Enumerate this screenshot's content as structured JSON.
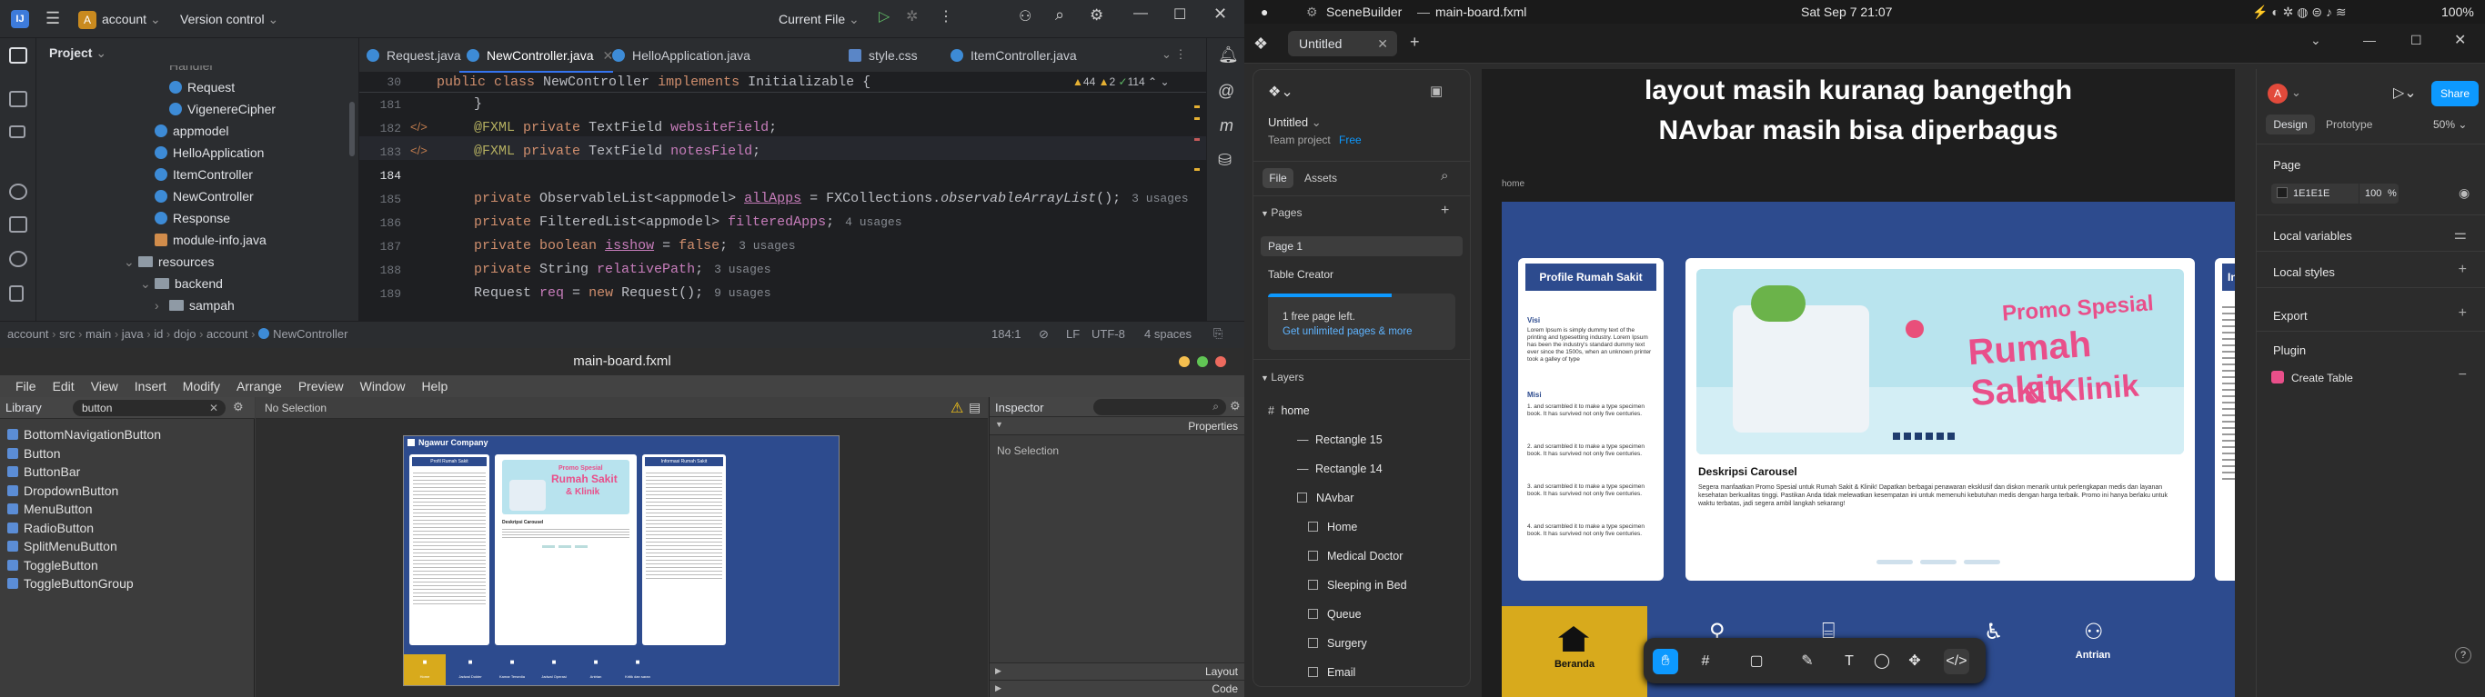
{
  "ide": {
    "project_name": "account",
    "project_initial": "A",
    "vcs_label": "Version control",
    "run_config": "Current File",
    "panel_title": "Project",
    "tabs": [
      {
        "label": "Request.java"
      },
      {
        "label": "NewController.java"
      },
      {
        "label": "HelloApplication.java"
      },
      {
        "label": "style.css"
      },
      {
        "label": "ItemController.java"
      }
    ],
    "tree": [
      {
        "label": "Request",
        "kind": "class"
      },
      {
        "label": "VigenereCipher",
        "kind": "class"
      },
      {
        "label": "appmodel",
        "kind": "class"
      },
      {
        "label": "HelloApplication",
        "kind": "class"
      },
      {
        "label": "ItemController",
        "kind": "class"
      },
      {
        "label": "NewController",
        "kind": "class"
      },
      {
        "label": "Response",
        "kind": "class"
      },
      {
        "label": "module-info.java",
        "kind": "file"
      },
      {
        "label": "resources",
        "kind": "folder"
      },
      {
        "label": "backend",
        "kind": "folder"
      },
      {
        "label": "sampah",
        "kind": "folder"
      }
    ],
    "sticky_line": "30",
    "sticky_code": "public class NewController implements Initializable {",
    "inspections": {
      "warnings": "44",
      "errors": "2",
      "checks": "114"
    },
    "lines": [
      "181",
      "182",
      "183",
      "184",
      "185",
      "186",
      "187",
      "188",
      "189"
    ],
    "hints": {
      "l185": "3 usages",
      "l186": "4 usages",
      "l187": "3 usages",
      "l188": "3 usages",
      "l189": "9 usages"
    },
    "breadcrumb": [
      "account",
      "src",
      "main",
      "java",
      "id",
      "dojo",
      "account",
      "NewController"
    ],
    "status": {
      "position": "184:1",
      "line_sep": "LF",
      "encoding": "UTF-8",
      "indent": "4 spaces"
    }
  },
  "scenebuilder": {
    "window_title": "main-board.fxml",
    "menu": [
      "File",
      "Edit",
      "View",
      "Insert",
      "Modify",
      "Arrange",
      "Preview",
      "Window",
      "Help"
    ],
    "library_label": "Library",
    "search_value": "button",
    "selection": "No Selection",
    "inspector_label": "Inspector",
    "properties_label": "Properties",
    "inspector_selection": "No Selection",
    "layout_label": "Layout",
    "code_label": "Code",
    "library_items": [
      "BottomNavigationButton",
      "Button",
      "ButtonBar",
      "DropdownButton",
      "MenuButton",
      "RadioButton",
      "SplitMenuButton",
      "ToggleButton",
      "ToggleButtonGroup"
    ],
    "preview": {
      "company": "Ngawur Company",
      "left_card": "Profil Rumah Sakit",
      "right_card": "Informasi Rumah Sakit",
      "banner_line1": "Promo Spesial",
      "banner_line2": "Rumah Sakit",
      "banner_line3": "& Klinik",
      "desc_title": "Deskripsi Carousel",
      "nav": [
        "Home",
        "Jadwal Dokter",
        "Kamar Tersedia",
        "Jadwal Operasi",
        "Antrian",
        "Kritik dan saran"
      ]
    }
  },
  "figma": {
    "app_name": "SceneBuilder",
    "window_title": "main-board.fxml",
    "clock": "Sat Sep 7  21:07",
    "battery": "100%",
    "tab_label": "Untitled",
    "file_name": "Untitled",
    "team": "Team project",
    "plan": "Free",
    "file_tab": "File",
    "assets_tab": "Assets",
    "pages_label": "Pages",
    "pages": [
      "Page 1",
      "Table Creator"
    ],
    "banner_text": "1 free page left.",
    "banner_link": "Get unlimited pages & more",
    "layers_label": "Layers",
    "layers": [
      {
        "label": "home",
        "indent": 0
      },
      {
        "label": "Rectangle 15",
        "indent": 1
      },
      {
        "label": "Rectangle 14",
        "indent": 1
      },
      {
        "label": "NAvbar",
        "indent": 1
      },
      {
        "label": "Home",
        "indent": 2
      },
      {
        "label": "Medical Doctor",
        "indent": 2
      },
      {
        "label": "Sleeping in Bed",
        "indent": 2
      },
      {
        "label": "Queue",
        "indent": 2
      },
      {
        "label": "Surgery",
        "indent": 2
      },
      {
        "label": "Email",
        "indent": 2
      }
    ],
    "note_line1": "layout masih kuranag bangethgh",
    "note_line2": "NAvbar masih bisa diperbagus",
    "frame_label": "home",
    "canvas": {
      "profil_title": "Profile Rumah Sakit",
      "info_title": "Inform",
      "visi": "Visi",
      "misi": "Misi",
      "lorem": "Lorem Ipsum is simply dummy text of the printing and typesetting industry. Lorem Ipsum has been the industry's standard dummy text ever since the 1500s, when an unknown printer took a galley of type",
      "misi_items": [
        "and scrambled it to make a type specimen book. It has survived not only five centuries.",
        "and scrambled it to make a type specimen book. It has survived not only five centuries.",
        "and scrambled it to make a type specimen book. It has survived not only five centuries.",
        "and scrambled it to make a type specimen book. It has survived not only five centuries."
      ],
      "banner_line1": "Promo Spesial",
      "banner_line2": "Rumah Sakit",
      "banner_line3": "& Klinik",
      "desc_title": "Deskripsi Carousel",
      "desc_text": "Segera manfaatkan Promo Spesial untuk Rumah Sakit & Klinik! Dapatkan berbagai penawaran eksklusif dan diskon menarik untuk perlengkapan medis dan layanan kesehatan berkualitas tinggi. Pastikan Anda tidak melewatkan kesempatan ini untuk memenuhi kebutuhan medis dengan harga terbaik. Promo ini hanya berlaku untuk waktu terbatas, jadi segera ambil langkah sekarang!",
      "nav_home": "Beranda",
      "nav_last": "Antrian"
    },
    "avatar_initial": "A",
    "share_label": "Share",
    "design_tab": "Design",
    "prototype_tab": "Prototype",
    "zoom": "50%",
    "page_section": "Page",
    "page_color": "1E1E1E",
    "page_opacity": "100",
    "page_opacity_unit": "%",
    "sections": [
      "Local variables",
      "Local styles",
      "Export",
      "Plugin"
    ],
    "plugin_item": "Create Table",
    "help": "?"
  }
}
